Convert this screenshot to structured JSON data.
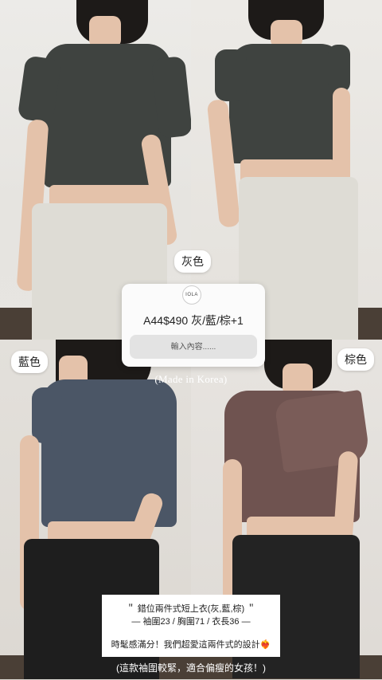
{
  "product": {
    "logo": "IOLA",
    "info": "A44$490 灰/藍/棕+1"
  },
  "input": {
    "placeholder": "輸入內容......"
  },
  "tags": {
    "gray": "灰色",
    "blue": "藍色",
    "brown": "棕色"
  },
  "overlay": {
    "made_in": "(Made in Korea)"
  },
  "caption": {
    "title": "＂ 錯位兩件式短上衣(灰,藍,棕) ＂",
    "size": "— 袖圍23 / 胸圍71 / 衣長36 —",
    "desc": "時髦感滿分！我們超愛這兩件式的設計❤️‍🔥",
    "note": "(這款袖圍較緊，適合偏瘦的女孩！)"
  },
  "colors": {
    "gray_top": "#3f4340",
    "blue_top": "#4b5666",
    "brown_top": "#6f5350",
    "white_pants": "#dedcd5",
    "black_pants": "#1e1e1e"
  }
}
